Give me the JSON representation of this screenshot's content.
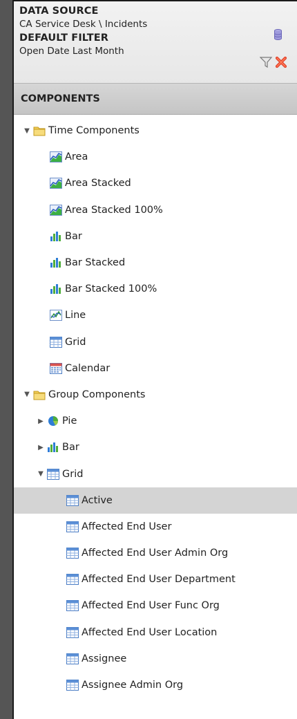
{
  "info": {
    "data_source_label": "DATA SOURCE",
    "data_source_value": "CA Service Desk \\ Incidents",
    "default_filter_label": "DEFAULT FILTER",
    "default_filter_value": "Open Date Last Month"
  },
  "components": {
    "header": "COMPONENTS",
    "time_group": {
      "label": "Time Components",
      "items": [
        "Area",
        "Area Stacked",
        "Area Stacked 100%",
        "Bar",
        "Bar Stacked",
        "Bar Stacked 100%",
        "Line",
        "Grid",
        "Calendar"
      ]
    },
    "group_group": {
      "label": "Group Components",
      "items": [
        "Pie",
        "Bar",
        "Grid"
      ],
      "grid_children": [
        "Active",
        "Affected End User",
        "Affected End User Admin Org",
        "Affected End User Department",
        "Affected End User Func Org",
        "Affected End User Location",
        "Assignee",
        "Assignee Admin Org"
      ]
    },
    "selected": "Active"
  },
  "colors": {
    "selection": "#d4d4d4",
    "header_bg": "#c9c9c9",
    "folder": "#f0c94a"
  }
}
